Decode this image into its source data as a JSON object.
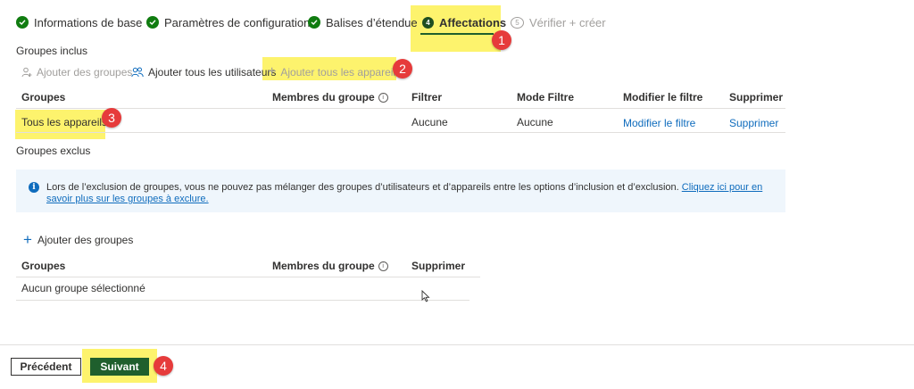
{
  "stepper": {
    "steps": [
      {
        "label": "Informations de base",
        "state": "done"
      },
      {
        "label": "Paramètres de configuration",
        "state": "done"
      },
      {
        "label": "Balises d’étendue",
        "state": "done"
      },
      {
        "label": "Affectations",
        "state": "active",
        "number": "4"
      },
      {
        "label": "Vérifier + créer",
        "state": "pending",
        "number": "5"
      }
    ]
  },
  "included": {
    "section_title": "Groupes inclus",
    "toolbar": {
      "add_groups": "Ajouter des groupes",
      "add_all_users": "Ajouter tous les utilisateurs",
      "add_all_devices": "Ajouter tous les appareils"
    },
    "columns": [
      "Groupes",
      "Membres du groupe",
      "Filtrer",
      "Mode Filtre",
      "Modifier le filtre",
      "Supprimer"
    ],
    "rows": [
      {
        "group": "Tous les appareils",
        "members": "",
        "filter": "Aucune",
        "filter_mode": "Aucune",
        "edit_filter": "Modifier le filtre",
        "delete": "Supprimer"
      }
    ]
  },
  "excluded": {
    "section_title": "Groupes exclus",
    "info_text": "Lors de l’exclusion de groupes, vous ne pouvez pas mélanger des groupes d’utilisateurs et d’appareils entre les options d’inclusion et d’exclusion. ",
    "info_link": "Cliquez ici pour en savoir plus sur les groupes à exclure.",
    "add_groups": "Ajouter des groupes",
    "columns": [
      "Groupes",
      "Membres du groupe",
      "Supprimer"
    ],
    "empty_text": "Aucun groupe sélectionné"
  },
  "footer": {
    "previous": "Précédent",
    "next": "Suivant"
  },
  "callouts": [
    "1",
    "2",
    "3",
    "4"
  ],
  "colors": {
    "success": "#107c10",
    "primary_button": "#1f5f2d",
    "link": "#0f6cbd",
    "highlight": "#fdf36d",
    "callout": "#e63b3b",
    "info_bg": "#eff6fc"
  }
}
